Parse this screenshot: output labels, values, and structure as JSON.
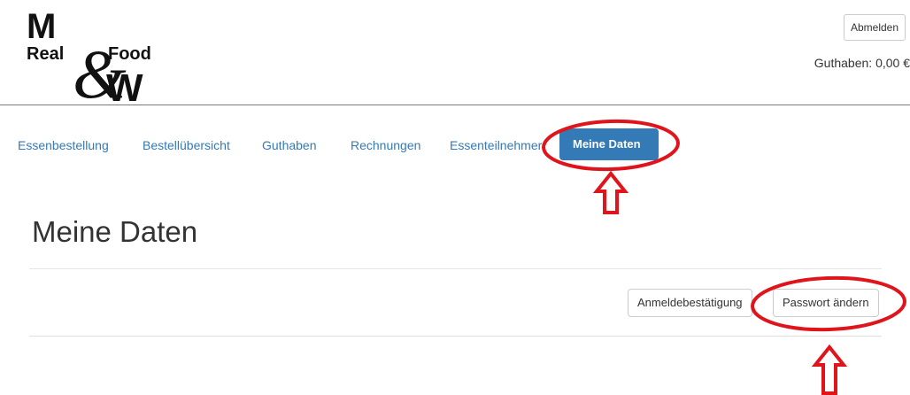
{
  "logo": {
    "letter_top": "M",
    "word_left": "Real",
    "ampersand": "&",
    "word_right": "Food",
    "letter_bottom": "W"
  },
  "header": {
    "logout_label": "Abmelden",
    "balance_text": "Guthaben: 0,00 €"
  },
  "nav": {
    "items": [
      {
        "label": "Essenbestellung",
        "active": false
      },
      {
        "label": "Bestellübersicht",
        "active": false
      },
      {
        "label": "Guthaben",
        "active": false
      },
      {
        "label": "Rechnungen",
        "active": false
      },
      {
        "label": "Essenteilnehmer",
        "active": false
      },
      {
        "label": "Meine Daten",
        "active": true
      }
    ]
  },
  "main": {
    "title": "Meine Daten",
    "buttons": {
      "confirmation_label": "Anmeldebestätigung",
      "change_password_label": "Passwort ändern"
    }
  },
  "annotations": {
    "color": "#e0141b",
    "marks": [
      "ellipse",
      "arrow-up",
      "ellipse",
      "arrow-up"
    ]
  },
  "colors": {
    "accent": "#337ab7",
    "text": "#333333",
    "annotation": "#e0141b"
  }
}
